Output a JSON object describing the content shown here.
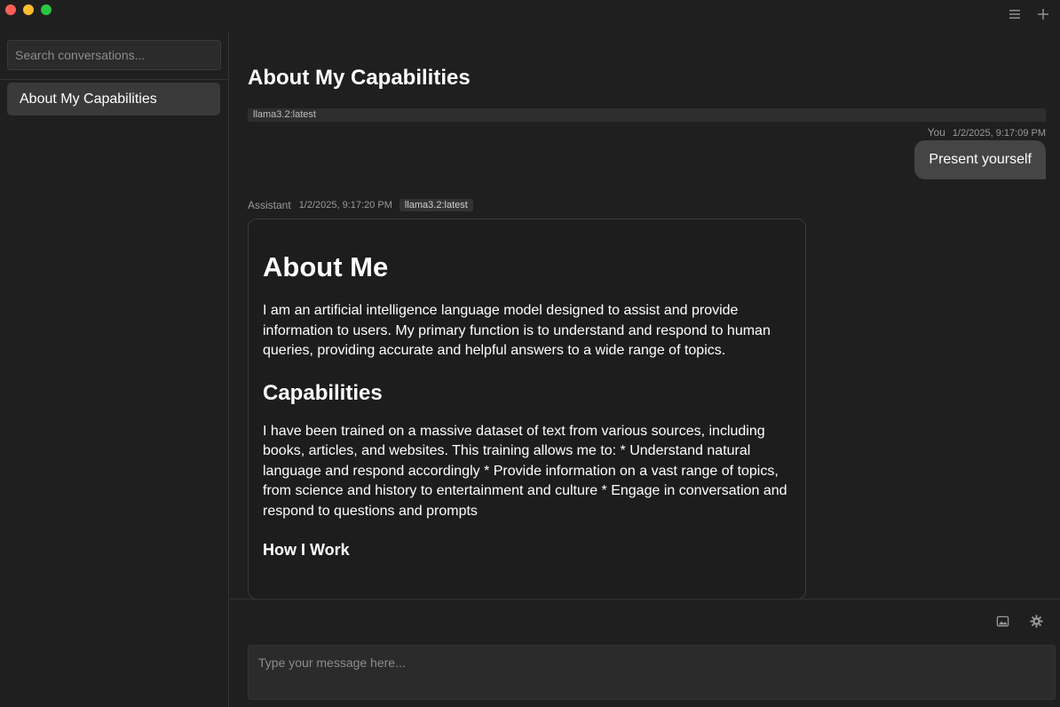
{
  "sidebar": {
    "search_placeholder": "Search conversations...",
    "conversations": [
      {
        "label": "About My Capabilities"
      }
    ]
  },
  "header_icons": [
    "menu-icon",
    "plus-icon"
  ],
  "conversation": {
    "title": "About My Capabilities",
    "model": "llama3.2:latest",
    "user_message": {
      "sender": "You",
      "timestamp": "1/2/2025, 9:17:09 PM",
      "text": "Present yourself"
    },
    "assistant_message": {
      "sender": "Assistant",
      "timestamp": "1/2/2025, 9:17:20 PM",
      "model_tag": "llama3.2:latest",
      "heading": "About Me",
      "intro": "I am an artificial intelligence language model designed to assist and provide information to users. My primary function is to understand and respond to human queries, providing accurate and helpful answers to a wide range of topics.",
      "section1_heading": "Capabilities",
      "section1_text": "I have been trained on a massive dataset of text from various sources, including books, articles, and websites. This training allows me to: * Understand natural language and respond accordingly * Provide information on a vast range of topics, from science and history to entertainment and culture * Engage in conversation and respond to questions and prompts",
      "section2_heading": "How I Work"
    }
  },
  "composer": {
    "placeholder": "Type your message here...",
    "tool_icons": [
      "image-icon",
      "gear-icon"
    ]
  }
}
